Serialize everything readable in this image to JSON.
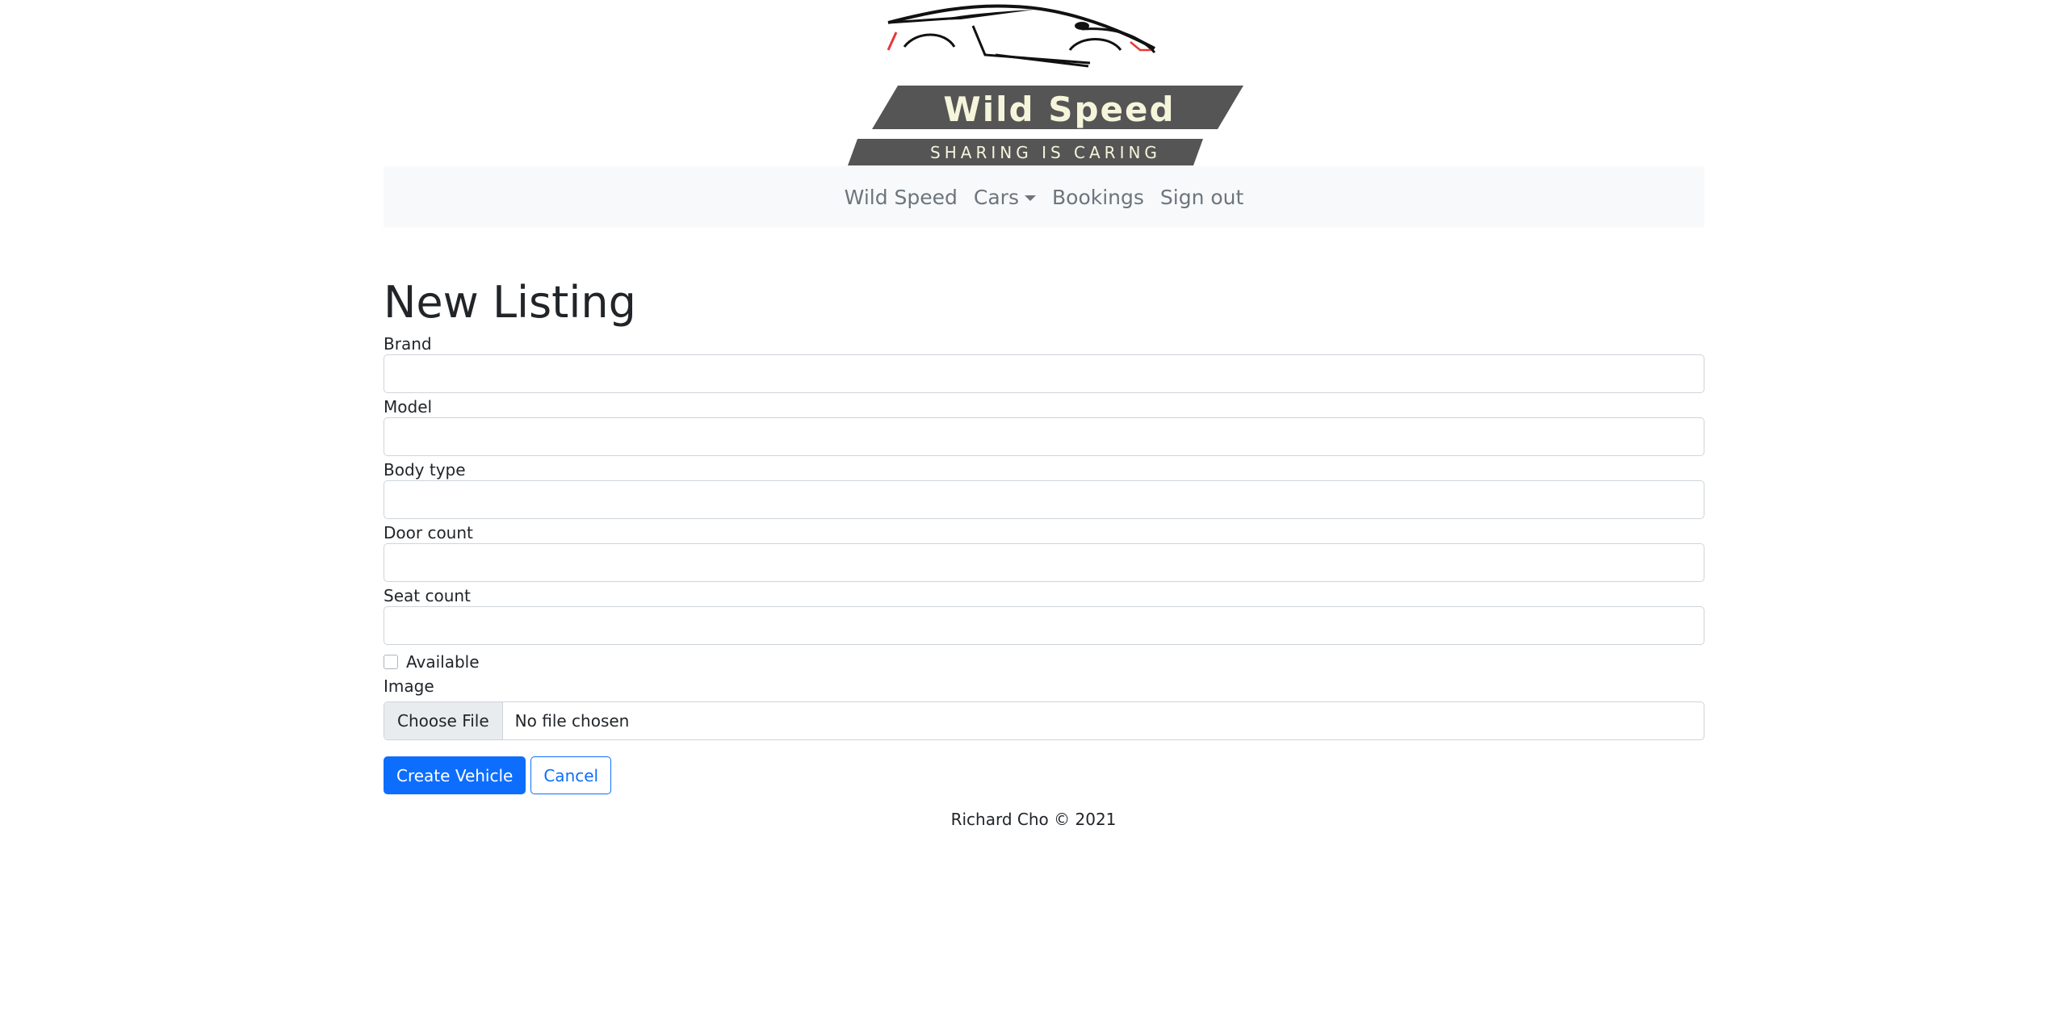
{
  "logo": {
    "title": "Wild Speed",
    "tagline": "SHARING IS CARING"
  },
  "nav": {
    "items": [
      {
        "label": "Wild Speed"
      },
      {
        "label": "Cars"
      },
      {
        "label": "Bookings"
      },
      {
        "label": "Sign out"
      }
    ]
  },
  "form": {
    "heading": "New Listing",
    "fields": [
      {
        "label": "Brand",
        "value": ""
      },
      {
        "label": "Model",
        "value": ""
      },
      {
        "label": "Body type",
        "value": ""
      },
      {
        "label": "Door count",
        "value": ""
      },
      {
        "label": "Seat count",
        "value": ""
      }
    ],
    "available_label": "Available",
    "available_checked": false,
    "image_label": "Image",
    "file_button": "Choose File",
    "file_status": "No file chosen",
    "submit_label": "Create Vehicle",
    "cancel_label": "Cancel"
  },
  "footer": {
    "text": "Richard Cho © 2021"
  },
  "colors": {
    "primary": "#0d6efd",
    "navbar_bg": "#f8f9fa",
    "logo_bar": "#555555",
    "accent_red": "#e53935"
  }
}
